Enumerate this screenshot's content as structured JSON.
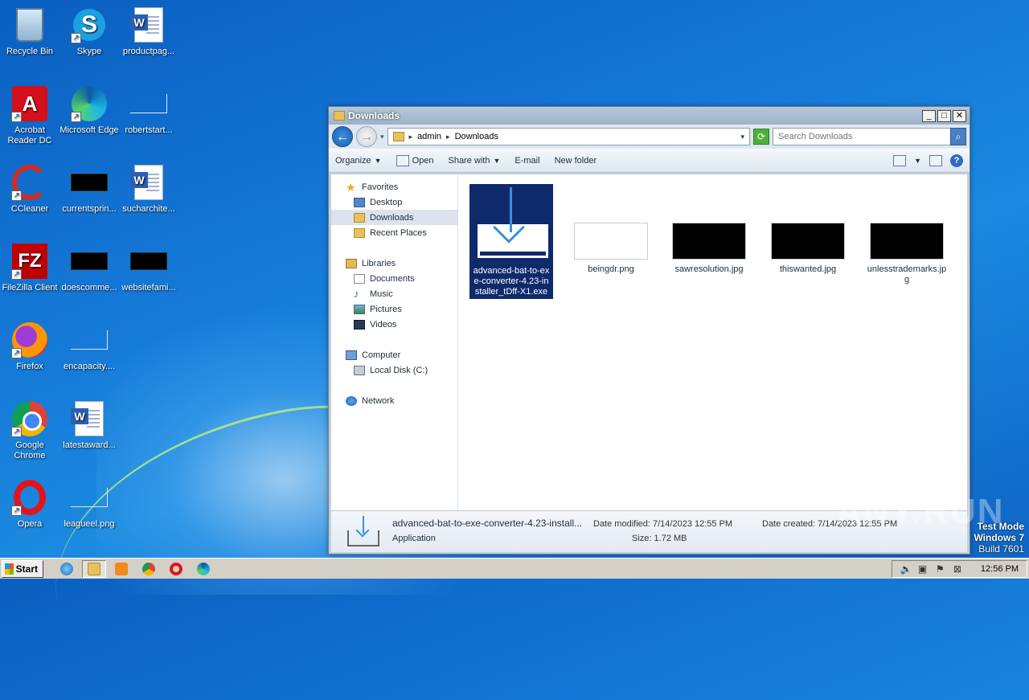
{
  "desktop": {
    "icons": [
      {
        "label": "Recycle Bin",
        "icon": "recycle-bin-icon"
      },
      {
        "label": "Skype",
        "icon": "skype-icon"
      },
      {
        "label": "productpag...",
        "icon": "word-doc-icon"
      },
      {
        "label": "Acrobat Reader DC",
        "icon": "acrobat-icon"
      },
      {
        "label": "Microsoft Edge",
        "icon": "edge-icon"
      },
      {
        "label": "robertstart...",
        "icon": "blank-file-icon"
      },
      {
        "label": "CCleaner",
        "icon": "ccleaner-icon"
      },
      {
        "label": "currentsprin...",
        "icon": "black-image-icon"
      },
      {
        "label": "sucharchite...",
        "icon": "word-doc-icon"
      },
      {
        "label": "FileZilla Client",
        "icon": "filezilla-icon"
      },
      {
        "label": "doescomme...",
        "icon": "black-image-icon"
      },
      {
        "label": "websitefami...",
        "icon": "black-image-icon"
      },
      {
        "label": "Firefox",
        "icon": "firefox-icon"
      },
      {
        "label": "encapacity....",
        "icon": "blank-file-icon"
      },
      {
        "label": "Google Chrome",
        "icon": "chrome-icon"
      },
      {
        "label": "latestaward...",
        "icon": "word-doc-icon"
      },
      {
        "label": "Opera",
        "icon": "opera-icon"
      },
      {
        "label": "leagueel.png",
        "icon": "blank-file-icon"
      }
    ]
  },
  "window": {
    "title": "Downloads",
    "breadcrumb": [
      "admin",
      "Downloads"
    ],
    "search_placeholder": "Search Downloads",
    "toolbar": {
      "organize": "Organize",
      "open": "Open",
      "share_with": "Share with",
      "email": "E-mail",
      "new_folder": "New folder"
    },
    "nav": {
      "favorites": "Favorites",
      "desktop": "Desktop",
      "downloads": "Downloads",
      "recent_places": "Recent Places",
      "libraries": "Libraries",
      "documents": "Documents",
      "music": "Music",
      "pictures": "Pictures",
      "videos": "Videos",
      "computer": "Computer",
      "local_disk": "Local Disk (C:)",
      "network": "Network"
    },
    "files": [
      {
        "name": "advanced-bat-to-exe-converter-4.23-installer_tDff-X1.exe",
        "kind": "installer",
        "selected": true
      },
      {
        "name": "beingdr.png",
        "kind": "white-image"
      },
      {
        "name": "sawresolution.jpg",
        "kind": "black-image"
      },
      {
        "name": "thiswanted.jpg",
        "kind": "black-image"
      },
      {
        "name": "unlesstrademarks.jpg",
        "kind": "black-image"
      }
    ],
    "status": {
      "name": "advanced-bat-to-exe-converter-4.23-install...",
      "type": "Application",
      "date_modified_label": "Date modified:",
      "date_modified": "7/14/2023 12:55 PM",
      "size_label": "Size:",
      "size": "1.72 MB",
      "date_created_label": "Date created:",
      "date_created": "7/14/2023 12:55 PM"
    }
  },
  "watermark": "ANY.RUN",
  "test_mode": {
    "line1": "Test Mode",
    "line2": "Windows 7",
    "line3": "Build 7601"
  },
  "taskbar": {
    "start": "Start",
    "apps": [
      "ie-icon",
      "explorer-icon",
      "media-player-icon",
      "chrome-icon",
      "opera-icon",
      "edge-icon"
    ],
    "clock": "12:56 PM"
  }
}
